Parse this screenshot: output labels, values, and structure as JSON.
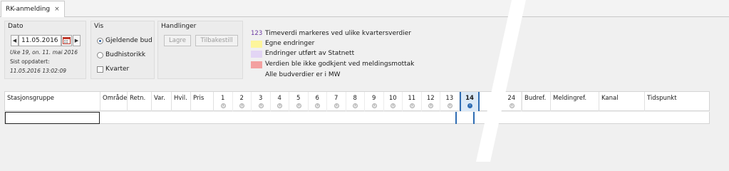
{
  "tab": {
    "label": "RK-anmelding",
    "close": "×"
  },
  "dato": {
    "title": "Dato",
    "date_value": "11.05.2016",
    "week_info": "Uke 19, on. 11. mai 2016",
    "updated_label": "Sist oppdatert:",
    "updated_value": "11.05.2016 13:02:09"
  },
  "vis": {
    "title": "Vis",
    "options": [
      "Gjeldende bud",
      "Budhistorikk"
    ],
    "selected": "Gjeldende bud",
    "checkbox_label": "Kvarter"
  },
  "handlinger": {
    "title": "Handlinger",
    "save_label": "Lagre",
    "reset_label": "Tilbakestill"
  },
  "legend": {
    "num_label": "123",
    "num_text": "Timeverdi markeres ved ulike kvartersverdier",
    "items": [
      {
        "text": "Egne endringer",
        "color": "#fdf59b"
      },
      {
        "text": "Endringer utført av Statnett",
        "color": "#e3d5f5"
      },
      {
        "text": "Verdien ble ikke godkjent ved meldingsmottak",
        "color": "#f3a0a0"
      }
    ],
    "unit_text": "Alle budverdier er i MW"
  },
  "grid": {
    "columns": [
      "Stasjonsgruppe",
      "Område",
      "Retn.",
      "Var.",
      "Hvil.",
      "Pris"
    ],
    "hours": [
      "1",
      "2",
      "3",
      "4",
      "5",
      "6",
      "7",
      "8",
      "9",
      "10",
      "11",
      "12",
      "13",
      "14"
    ],
    "selected_hour": "14",
    "after_hour": "24",
    "tail_columns": [
      "Budref.",
      "Meldingref.",
      "Kanal",
      "Tidspunkt"
    ]
  },
  "colors": {
    "accent": "#2f6db3",
    "selected_bg": "#dbe9f7"
  }
}
